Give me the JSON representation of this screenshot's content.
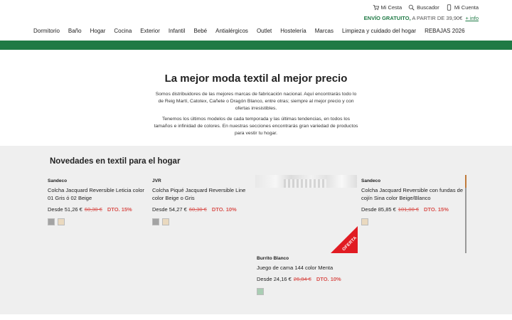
{
  "utility": {
    "cart": "Mi Cesta",
    "search": "Buscador",
    "account": "Mi Cuenta"
  },
  "shipping": {
    "free": "ENVÍO GRATUITO,",
    "rest": "A PARTIR DE 39,90€",
    "more": "+ info"
  },
  "nav": [
    "Dormitorio",
    "Baño",
    "Hogar",
    "Cocina",
    "Exterior",
    "Infantil",
    "Bebé",
    "Antialérgicos",
    "Outlet",
    "Hostelería",
    "Marcas",
    "Limpieza y cuidado del hogar",
    "REBAJAS 2026"
  ],
  "hero": {
    "title": "La mejor moda textil al mejor precio",
    "p1": "Somos distribuidores de las mejores marcas de fabricación nacional. Aquí encontrarás todo lo de Reig Martí, Catotex, Cañete o Dragón Blanco, entre otras; siempre al mejor precio y con ofertas irresistibles.",
    "p2": "Tenemos los últimos modelos de cada temporada y las últimas tendencias, en todos los tamaños e infinidad de colores. En nuestras secciones encontrarás gran variedad de productos para vestir tu hogar."
  },
  "section": {
    "title": "Novedades en textil para el hogar"
  },
  "products": [
    {
      "brand": "Sandeco",
      "name": "Colcha Jacquard Reversible Leticia color 01 Gris ó 02 Beige",
      "price": "Desde 51,26 €",
      "old": "60,30 €",
      "dto": "DTO. 15%",
      "swatches": [
        "#a3a3a3",
        "#ead9bf"
      ]
    },
    {
      "brand": "JVR",
      "name": "Colcha Piqué Jacquard Reversible Line color Beige o Gris",
      "price": "Desde 54,27 €",
      "old": "60,30 €",
      "dto": "DTO. 10%",
      "swatches": [
        "#a3a3a3",
        "#ead9bf"
      ]
    },
    {
      "brand": "Burrito Blanco",
      "name": "Juego de cama 144 color Menta",
      "price": "Desde 24,16 €",
      "old": "26,84 €",
      "dto": "DTO. 10%",
      "swatches": [
        "#a9cdb3"
      ],
      "badge": "OFERTA"
    },
    {
      "brand": "Sandeco",
      "name": "Colcha Jacquard Reversible con fundas de cojín Sina color Beige/Blanco",
      "price": "Desde 85,85 €",
      "old": "101,00 €",
      "dto": "DTO. 15%",
      "swatches": [
        "#ead9bf"
      ]
    }
  ],
  "colors": {
    "brand_green": "#1f7a45",
    "sale_red": "#d9534f",
    "badge_red": "#e11b22"
  }
}
